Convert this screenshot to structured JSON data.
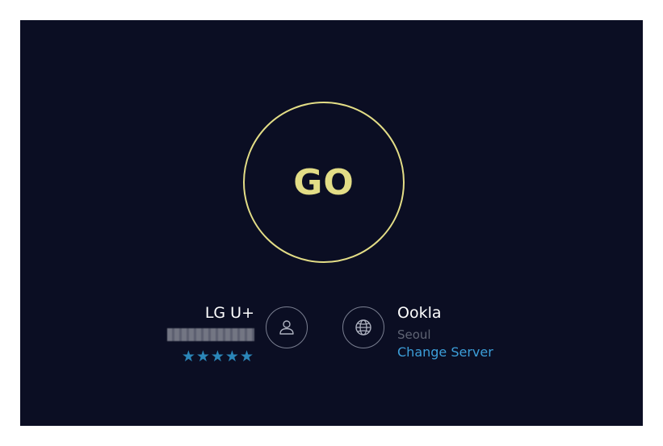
{
  "go_button": {
    "label": "GO"
  },
  "isp": {
    "name": "LG U+",
    "rating_stars": 5,
    "stars": "★★★★★"
  },
  "server": {
    "name": "Ookla",
    "city": "Seoul",
    "change_label": "Change Server"
  },
  "icons": {
    "isp": "user-icon",
    "server": "globe-icon"
  },
  "colors": {
    "background": "#0b0e23",
    "go_accent": "#e3dd86",
    "link": "#3c9ed9",
    "stars": "#2b86b8"
  }
}
